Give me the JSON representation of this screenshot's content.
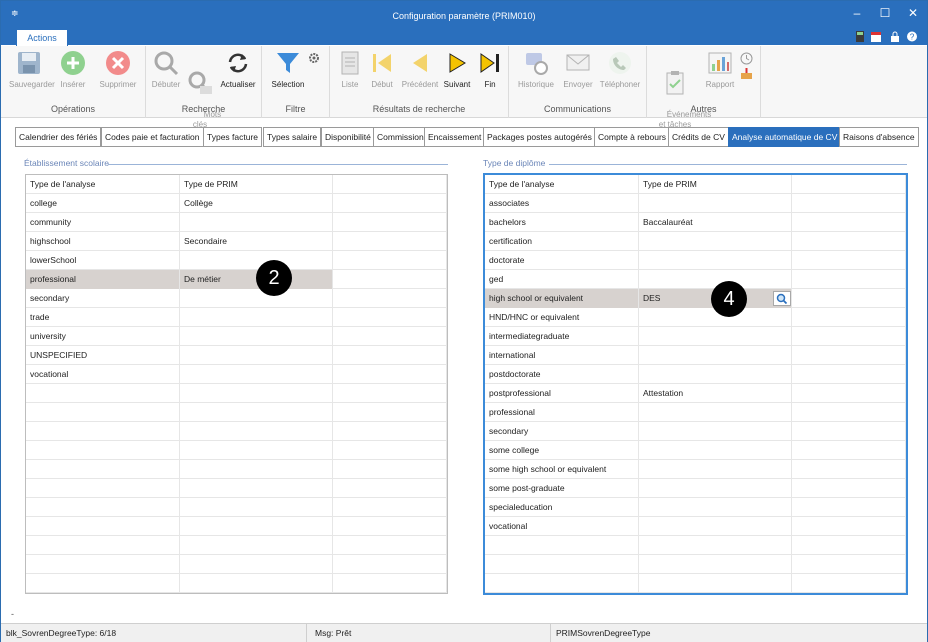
{
  "window": {
    "title": "Configuration paramètre (PRIM010)"
  },
  "ribbon_tab": {
    "label": "Actions"
  },
  "ribbon": {
    "groups": [
      {
        "label": "Opérations",
        "buttons": [
          {
            "label": "Sauvegarder",
            "icon": "save-icon"
          },
          {
            "label": "Insérer",
            "icon": "plus-icon"
          },
          {
            "label": "Supprimer",
            "icon": "delete-icon"
          }
        ]
      },
      {
        "label": "Recherche",
        "buttons": [
          {
            "label": "Débuter",
            "icon": "search-icon"
          },
          {
            "label": "Mots\nclés",
            "icon": "keyword-search-icon"
          },
          {
            "label": "Actualiser",
            "icon": "refresh-icon"
          }
        ]
      },
      {
        "label": "Filtre",
        "buttons": [
          {
            "label": "Sélection",
            "icon": "filter-icon"
          }
        ]
      },
      {
        "label": "Résultats de recherche",
        "buttons": [
          {
            "label": "Liste",
            "icon": "list-icon"
          },
          {
            "label": "Début",
            "icon": "first-icon"
          },
          {
            "label": "Précédent",
            "icon": "previous-icon"
          },
          {
            "label": "Suivant",
            "icon": "next-icon"
          },
          {
            "label": "Fin",
            "icon": "last-icon"
          }
        ]
      },
      {
        "label": "Communications",
        "buttons": [
          {
            "label": "Historique",
            "icon": "history-icon"
          },
          {
            "label": "Envoyer",
            "icon": "envelope-icon"
          },
          {
            "label": "Téléphoner",
            "icon": "phone-icon"
          }
        ]
      },
      {
        "label": "Autres",
        "buttons": [
          {
            "label": "Événements\net tâches",
            "icon": "clipboard-icon"
          },
          {
            "label": "Rapport",
            "icon": "report-chart-icon"
          }
        ]
      }
    ]
  },
  "tabs": [
    "Calendrier des fériés",
    "Codes paie et facturation",
    "Types facture",
    "Types salaire",
    "Disponibilité",
    "Commission",
    "Encaissement",
    "Packages postes autogérés",
    "Compte à rebours",
    "Crédits de CV",
    "Analyse automatique de CV",
    "Raisons d'absence"
  ],
  "left_panel": {
    "legend": "Établissement scolaire",
    "columns": [
      "Type de l'analyse",
      "Type de PRIM"
    ],
    "rows": [
      [
        "college",
        "Collège"
      ],
      [
        "community",
        ""
      ],
      [
        "highschool",
        "Secondaire"
      ],
      [
        "lowerSchool",
        ""
      ],
      [
        "professional",
        "De métier"
      ],
      [
        "secondary",
        ""
      ],
      [
        "trade",
        ""
      ],
      [
        "university",
        ""
      ],
      [
        "UNSPECIFIED",
        ""
      ],
      [
        "vocational",
        ""
      ]
    ],
    "badge": "2"
  },
  "right_panel": {
    "legend": "Type de diplôme",
    "columns": [
      "Type de l'analyse",
      "Type de PRIM"
    ],
    "rows": [
      [
        "associates",
        ""
      ],
      [
        "bachelors",
        "Baccalauréat"
      ],
      [
        "certification",
        ""
      ],
      [
        "doctorate",
        ""
      ],
      [
        "ged",
        ""
      ],
      [
        "high school or equivalent",
        "DES"
      ],
      [
        "HND/HNC or equivalent",
        ""
      ],
      [
        "intermediategraduate",
        ""
      ],
      [
        "international",
        ""
      ],
      [
        "postdoctorate",
        ""
      ],
      [
        "postprofessional",
        "Attestation"
      ],
      [
        "professional",
        ""
      ],
      [
        "secondary",
        ""
      ],
      [
        "some college",
        ""
      ],
      [
        "some high school or equivalent",
        ""
      ],
      [
        "some post-graduate",
        ""
      ],
      [
        "specialeducation",
        ""
      ],
      [
        "vocational",
        ""
      ]
    ],
    "badge": "4"
  },
  "status": {
    "record": "blk_SovrenDegreeType: 6/18",
    "message": "Msg: Prêt",
    "object": "PRIMSovrenDegreeType"
  },
  "colors": {
    "accent": "#2a6fbd",
    "highlight_row": "#d7d2cf"
  }
}
